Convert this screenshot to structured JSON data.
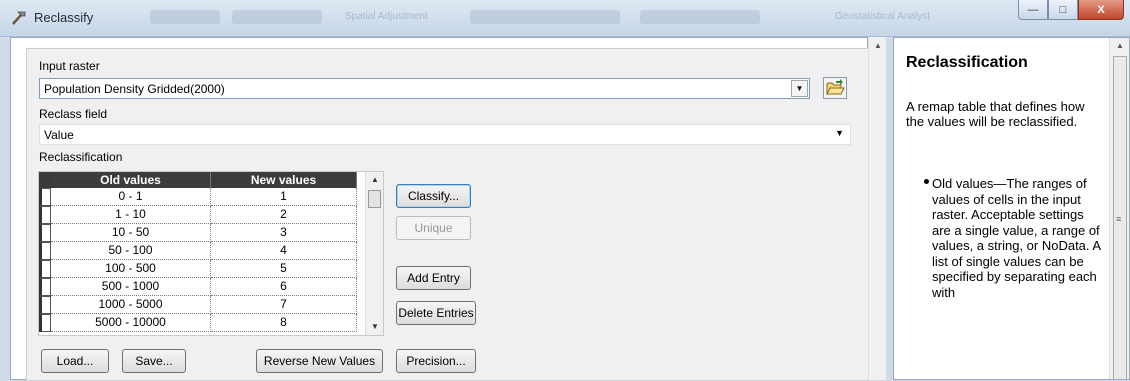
{
  "window": {
    "title": "Reclassify",
    "toolbar_hints": [
      "Spatial Adjustment",
      "Geostatistical Analyst"
    ],
    "controls": {
      "minimize": "—",
      "maximize": "□",
      "close": "X"
    }
  },
  "form": {
    "input_raster": {
      "label": "Input raster",
      "value": "Population Density Gridded(2000)"
    },
    "reclass_field": {
      "label": "Reclass field",
      "value": "Value"
    },
    "reclassification": {
      "label": "Reclassification",
      "columns": [
        "Old values",
        "New values"
      ],
      "rows": [
        {
          "old": "0 - 1",
          "new": "1"
        },
        {
          "old": "1 - 10",
          "new": "2"
        },
        {
          "old": "10 - 50",
          "new": "3"
        },
        {
          "old": "50 - 100",
          "new": "4"
        },
        {
          "old": "100 - 500",
          "new": "5"
        },
        {
          "old": "500 - 1000",
          "new": "6"
        },
        {
          "old": "1000 - 5000",
          "new": "7"
        },
        {
          "old": "5000 - 10000",
          "new": "8"
        }
      ]
    },
    "buttons": {
      "classify": "Classify...",
      "unique": "Unique",
      "add_entry": "Add Entry",
      "delete_entries": "Delete Entries",
      "load": "Load...",
      "save": "Save...",
      "reverse": "Reverse New Values",
      "precision": "Precision..."
    }
  },
  "help": {
    "title": "Reclassification",
    "description": "A remap table that defines how the values will be reclassified.",
    "bullet": "Old values—The ranges of values of cells in the input raster. Acceptable settings are a single value, a range of values, a string, or NoData. A list of single values can be specified by separating each with"
  },
  "colors": {
    "header_bg": "#3c3c3c",
    "default_button_border": "#3c7fb1",
    "close_button": "#c0462a"
  }
}
